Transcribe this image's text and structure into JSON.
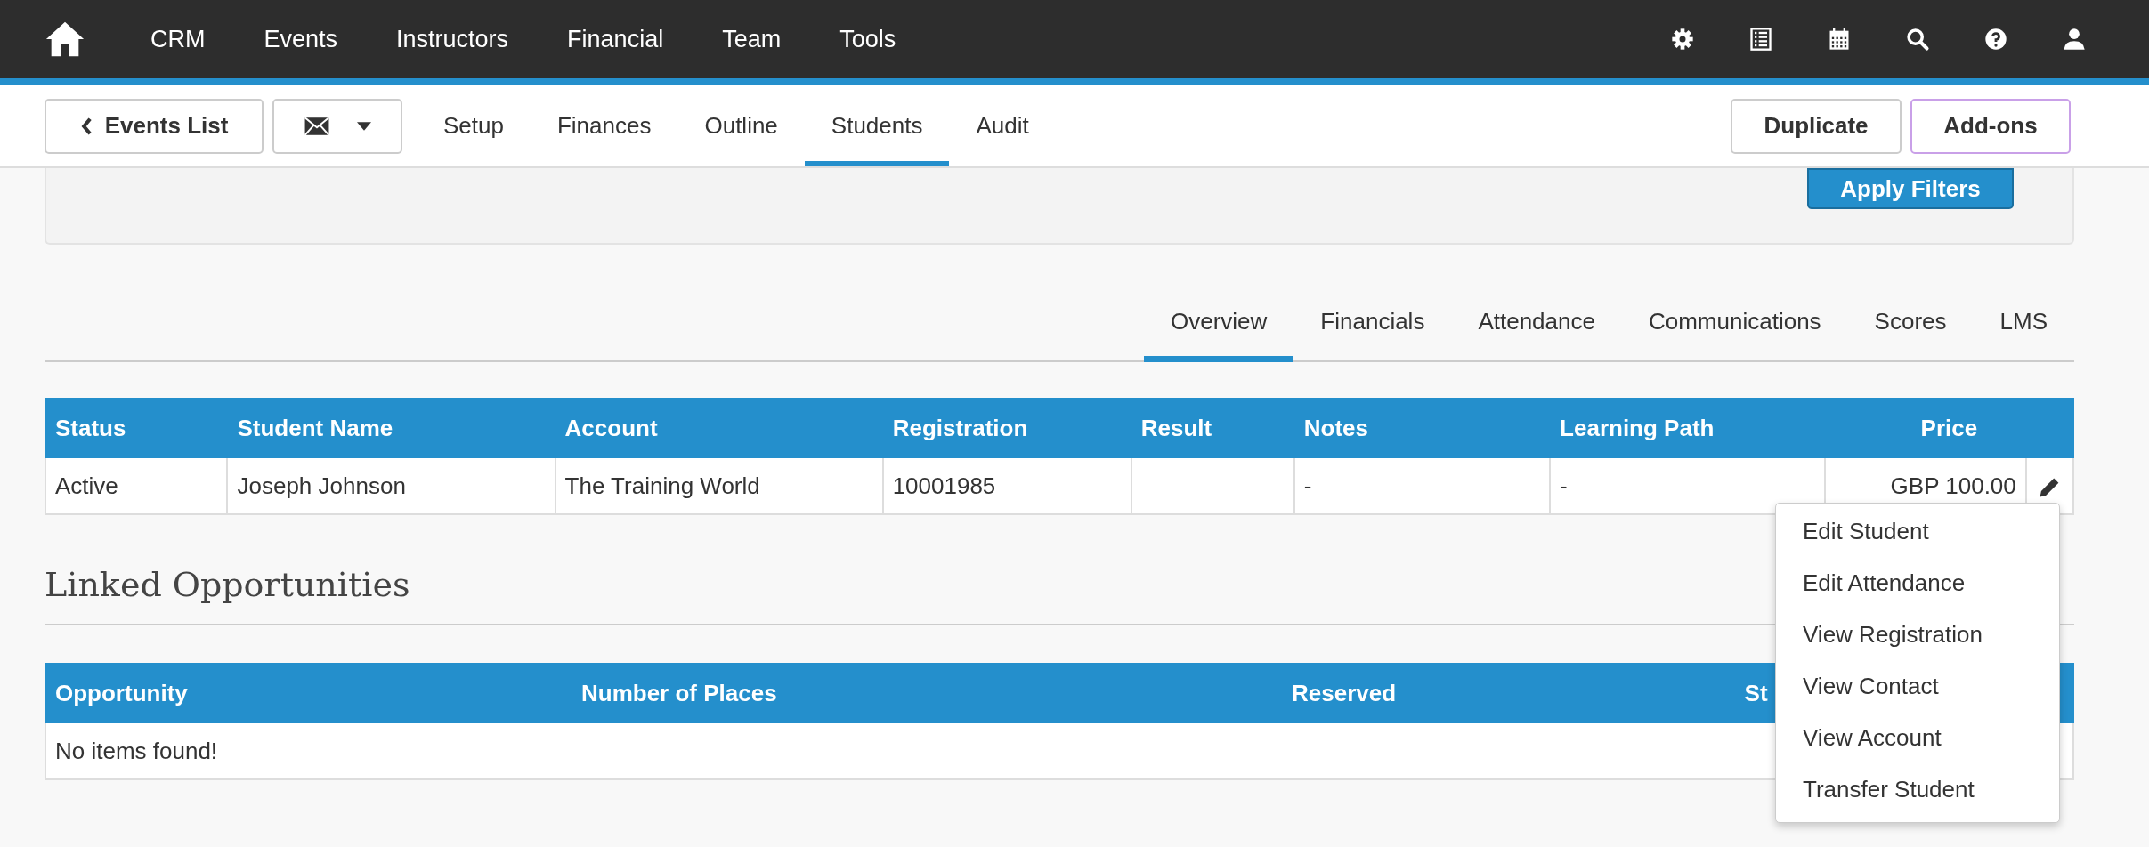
{
  "top_nav": {
    "items": [
      "CRM",
      "Events",
      "Instructors",
      "Financial",
      "Team",
      "Tools"
    ]
  },
  "sub_nav": {
    "back_button": "Events List",
    "tabs": [
      {
        "label": "Setup",
        "selected": false
      },
      {
        "label": "Finances",
        "selected": false
      },
      {
        "label": "Outline",
        "selected": false
      },
      {
        "label": "Students",
        "selected": true
      },
      {
        "label": "Audit",
        "selected": false
      }
    ],
    "buttons": [
      {
        "label": "Duplicate",
        "kind": "plain"
      },
      {
        "label": "Add-ons",
        "kind": "accent"
      }
    ]
  },
  "filters": {
    "apply_button": "Apply Filters"
  },
  "student_tabs": [
    {
      "label": "Overview",
      "selected": true
    },
    {
      "label": "Financials",
      "selected": false
    },
    {
      "label": "Attendance",
      "selected": false
    },
    {
      "label": "Communications",
      "selected": false
    },
    {
      "label": "Scores",
      "selected": false
    },
    {
      "label": "LMS",
      "selected": false
    }
  ],
  "students_table": {
    "columns": [
      "Status",
      "Student Name",
      "Account",
      "Registration",
      "Result",
      "Notes",
      "Learning Path",
      "Price"
    ],
    "rows": [
      {
        "cells": [
          "Active",
          "Joseph Johnson",
          "The Training World",
          "10001985",
          "",
          "-",
          "-",
          "GBP 100.00"
        ]
      }
    ]
  },
  "linked_opportunities": {
    "title": "Linked Opportunities",
    "columns": [
      "Opportunity",
      "Number of Places",
      "Reserved",
      "St"
    ],
    "empty_message": "No items found!"
  },
  "row_menu": {
    "items": [
      "Edit Student",
      "Edit Attendance",
      "View Registration",
      "View Contact",
      "View Account",
      "Transfer Student"
    ]
  }
}
